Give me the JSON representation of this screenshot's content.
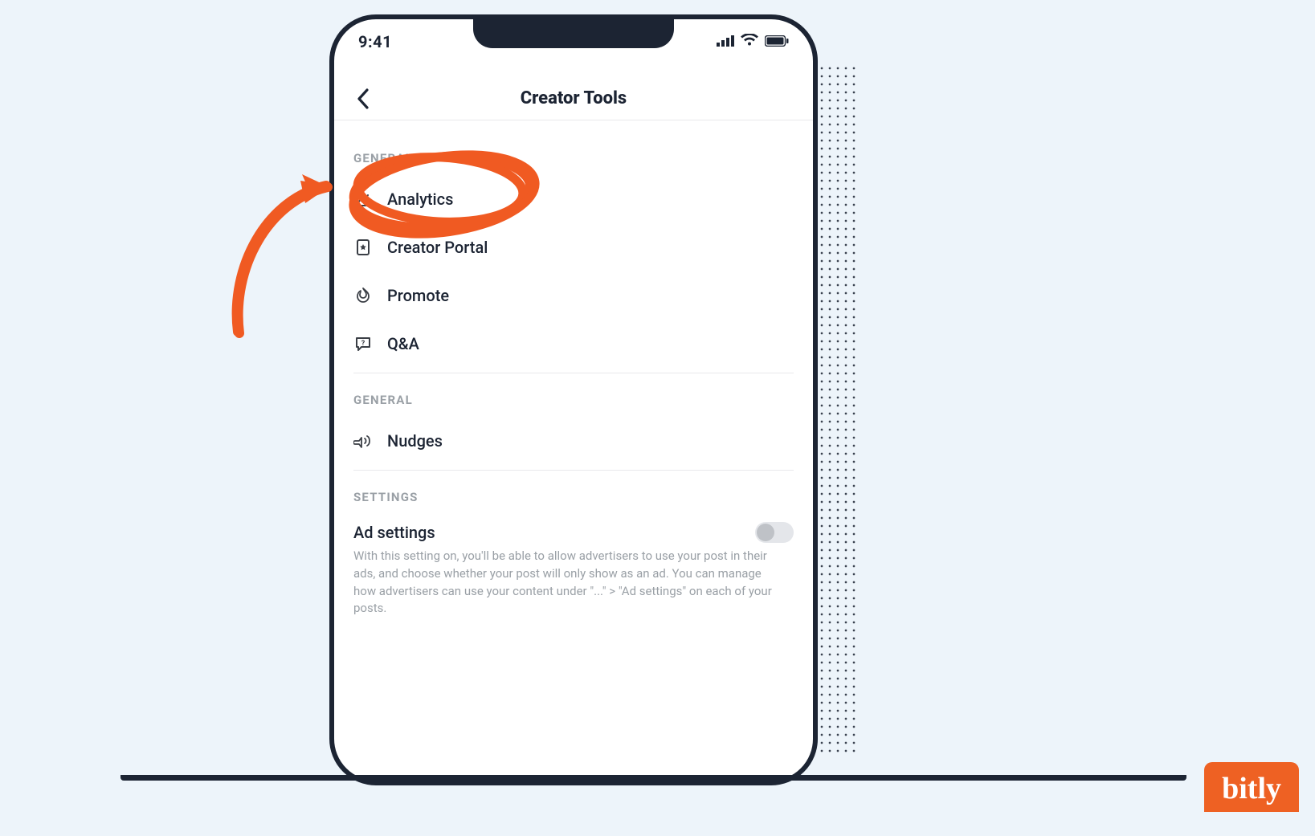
{
  "status_bar": {
    "time": "9:41"
  },
  "header": {
    "title": "Creator Tools"
  },
  "sections": {
    "general1": {
      "header": "GENERAL",
      "items": {
        "analytics": {
          "label": "Analytics"
        },
        "creator_portal": {
          "label": "Creator Portal"
        },
        "promote": {
          "label": "Promote"
        },
        "qa": {
          "label": "Q&A"
        }
      }
    },
    "general2": {
      "header": "GENERAL",
      "items": {
        "nudges": {
          "label": "Nudges"
        }
      }
    },
    "settings": {
      "header": "SETTINGS",
      "ad_settings": {
        "title": "Ad settings",
        "toggle_on": false,
        "description": "With this setting on, you'll be able to allow advertisers to use your post in their ads, and choose whether your post will only show as an ad. You can manage how advertisers can use your content under \"...\" > \"Ad settings\" on each of your posts."
      }
    }
  },
  "annotation": {
    "highlight_color": "#f05a22",
    "highlighted_item": "analytics"
  },
  "branding": {
    "badge_text": "bitly",
    "badge_color": "#ee6123"
  }
}
